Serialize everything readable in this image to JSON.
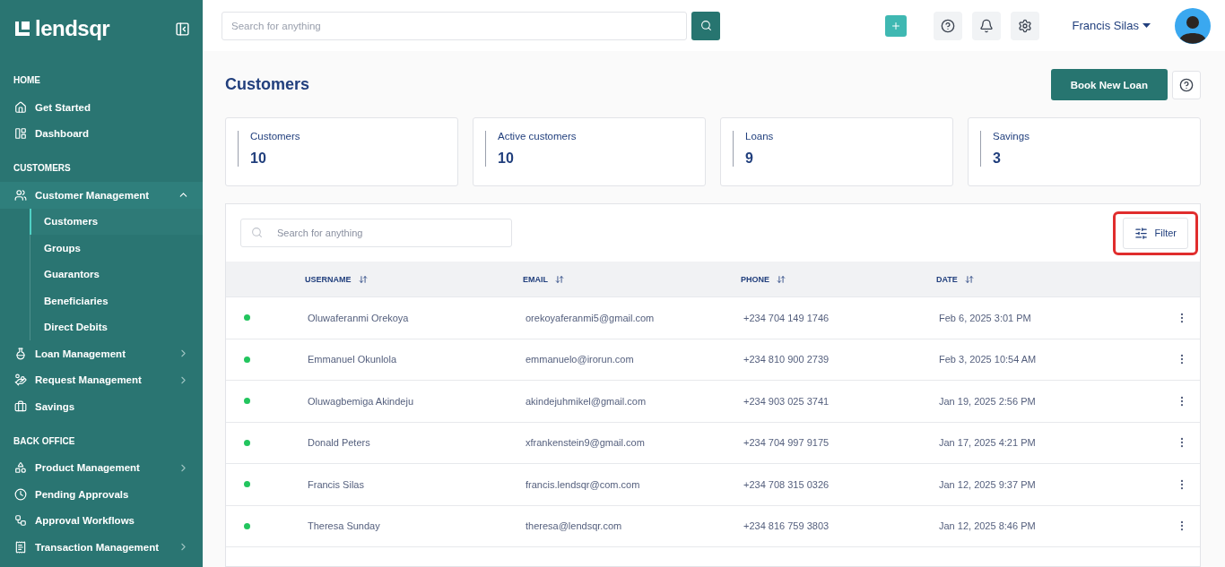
{
  "sidebar": {
    "logo": "lendsqr",
    "sections": [
      {
        "title": "HOME",
        "items": [
          {
            "label": "Get Started"
          },
          {
            "label": "Dashboard"
          }
        ]
      },
      {
        "title": "CUSTOMERS",
        "items": [
          {
            "label": "Customer Management",
            "expanded": true,
            "children": [
              {
                "label": "Customers",
                "selected": true
              },
              {
                "label": "Groups",
                "selected": false
              },
              {
                "label": "Guarantors",
                "selected": false
              },
              {
                "label": "Beneficiaries",
                "selected": false
              },
              {
                "label": "Direct Debits",
                "selected": false
              }
            ]
          },
          {
            "label": "Loan Management",
            "expanded": false
          },
          {
            "label": "Request Management",
            "expanded": false
          },
          {
            "label": "Savings"
          }
        ]
      },
      {
        "title": "BACK OFFICE",
        "items": [
          {
            "label": "Product Management",
            "expanded": false
          },
          {
            "label": "Pending Approvals"
          },
          {
            "label": "Approval Workflows"
          },
          {
            "label": "Transaction Management",
            "expanded": false
          }
        ]
      }
    ]
  },
  "topbar": {
    "search": {
      "placeholder": "Search for anything"
    },
    "user": "Francis Silas"
  },
  "page": {
    "title": "Customers",
    "primary_button": "Book New Loan"
  },
  "stats": [
    {
      "label": "Customers",
      "value": "10"
    },
    {
      "label": "Active customers",
      "value": "10"
    },
    {
      "label": "Loans",
      "value": "9"
    },
    {
      "label": "Savings",
      "value": "3"
    }
  ],
  "table": {
    "search": {
      "placeholder": "Search for anything"
    },
    "filter_button": {
      "label": "Filter",
      "highlighted": true
    },
    "columns": [
      {
        "label": "USERNAME"
      },
      {
        "label": "EMAIL"
      },
      {
        "label": "PHONE"
      },
      {
        "label": "DATE"
      }
    ],
    "rows": [
      {
        "color": "#22c55e",
        "cells": [
          "Oluwaferanmi Orekoya",
          "orekoyaferanmi5@gmail.com",
          "+234 704 149 1746",
          "Feb 6, 2025 3:01 PM"
        ]
      },
      {
        "color": "#22c55e",
        "cells": [
          "Emmanuel Okunlola",
          "emmanuelo@irorun.com",
          "+234 810 900 2739",
          "Feb 3, 2025 10:54 AM"
        ]
      },
      {
        "color": "#22c55e",
        "cells": [
          "Oluwagbemiga Akindeju",
          "akindejuhmikel@gmail.com",
          "+234 903 025 3741",
          "Jan 19, 2025 2:56 PM"
        ]
      },
      {
        "color": "#22c55e",
        "cells": [
          "Donald Peters",
          "xfrankenstein9@gmail.com",
          "+234 704 997 9175",
          "Jan 17, 2025 4:21 PM"
        ]
      },
      {
        "color": "#22c55e",
        "cells": [
          "Francis Silas",
          "francis.lendsqr@com.com",
          "+234 708 315 0326",
          "Jan 12, 2025 9:37 PM"
        ]
      },
      {
        "color": "#22c55e",
        "cells": [
          "Theresa Sunday",
          "theresa@lendsqr.com",
          "+234 816 759 3803",
          "Jan 12, 2025 8:46 PM"
        ]
      }
    ]
  }
}
